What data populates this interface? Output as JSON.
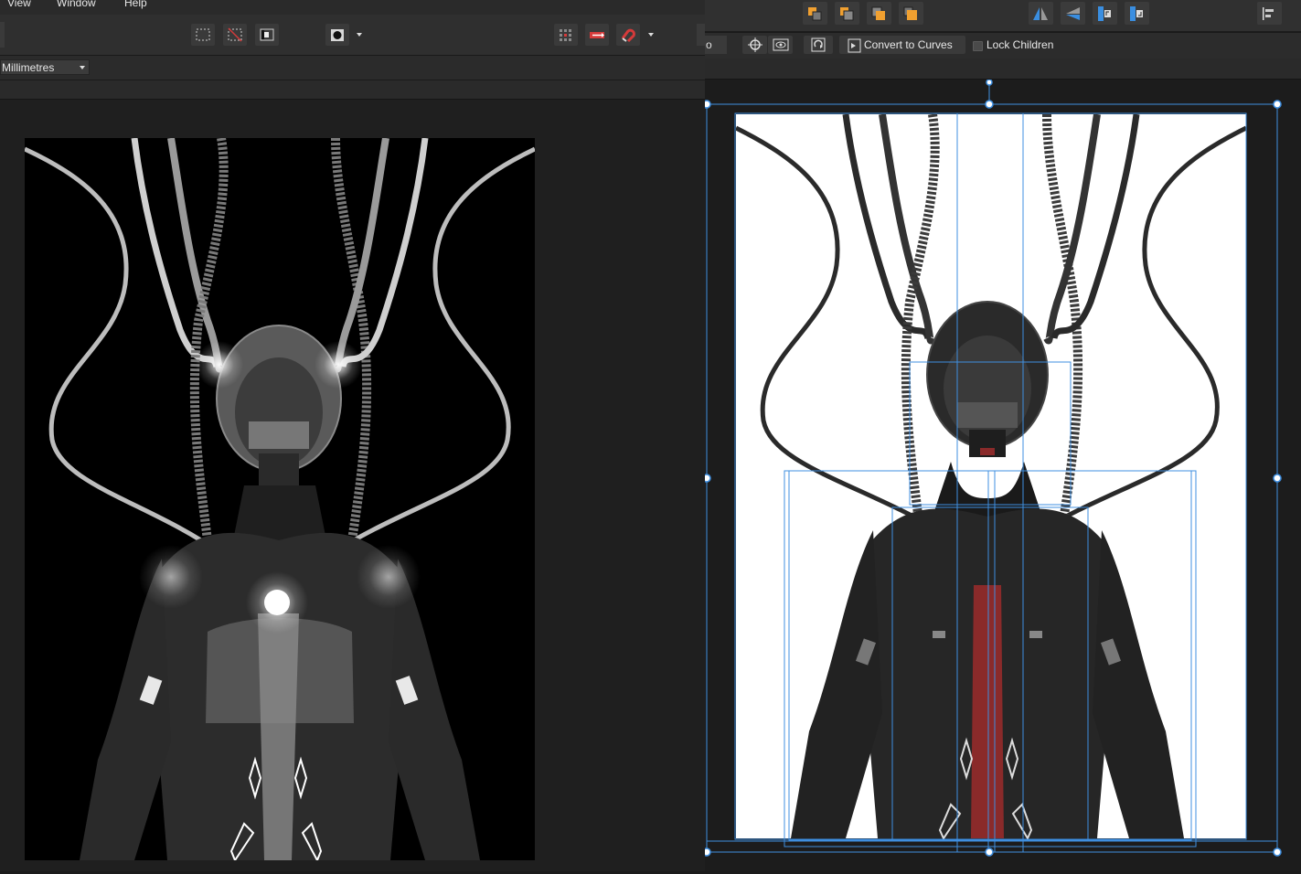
{
  "menubar": {
    "items": [
      "View",
      "Window",
      "Help"
    ]
  },
  "toolbar_left": {
    "units": "Millimetres"
  },
  "context_toolbar_right": {
    "truncated_field": "o",
    "convert_button": "Convert to Curves",
    "lock_children_label": "Lock Children",
    "lock_children_checked": false
  },
  "colors": {
    "selection_blue": "#3f8fe0",
    "snapping_red": "#d63a3a",
    "accent_orange": "#f0a030",
    "flip_blue": "#3a8ee0",
    "vest_red": "#8a2a2a"
  },
  "icons": {
    "left_toolbar": [
      "marquee-select-icon",
      "deselect-icon",
      "invert-selection-icon",
      "record-icon",
      "dropdown-caret-icon",
      "grid-icon",
      "snapping-options-icon",
      "magnet-icon",
      "dropdown-caret-icon"
    ],
    "right_toolbar": [
      "move-to-back-icon",
      "move-back-icon",
      "move-forward-icon",
      "move-to-front-icon",
      "flip-horizontal-icon",
      "flip-vertical-icon",
      "rotate-left-icon",
      "rotate-right-icon",
      "align-icon"
    ],
    "right_context": [
      "target-icon",
      "view-icon",
      "transform-icon",
      "convert-to-curves-icon"
    ]
  }
}
